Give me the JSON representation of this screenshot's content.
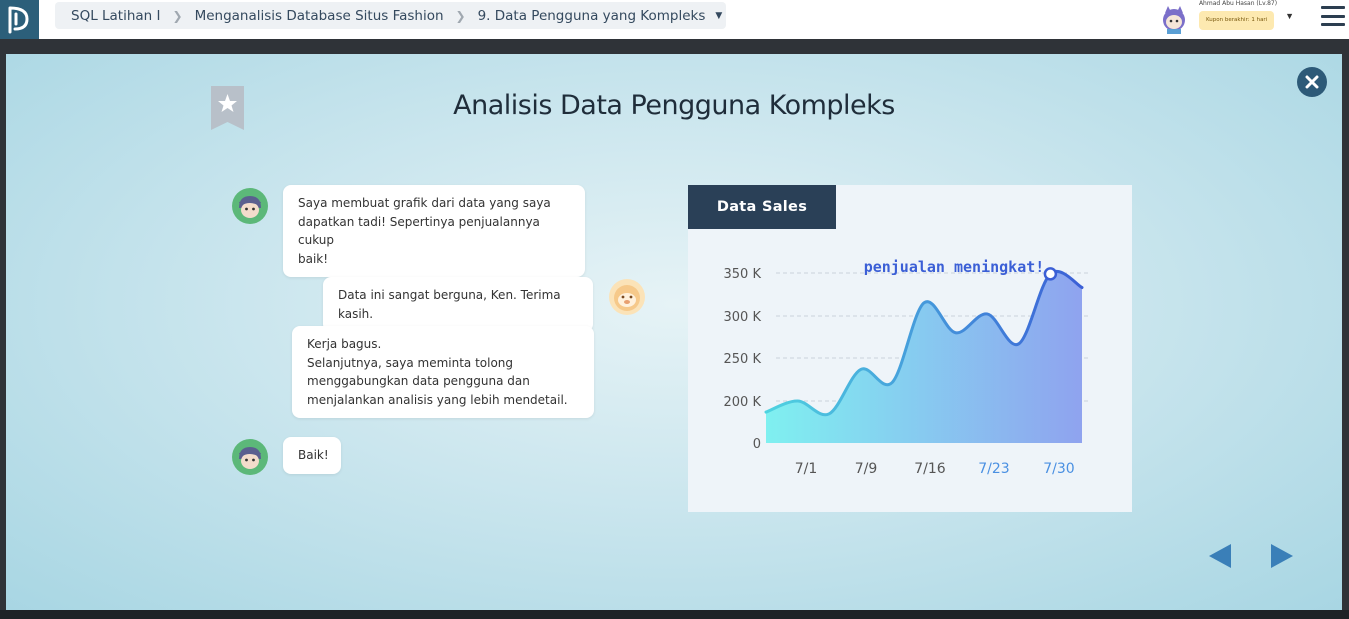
{
  "header": {
    "breadcrumb": [
      {
        "label": "SQL Latihan I"
      },
      {
        "label": "Menganalisis Database Situs Fashion"
      },
      {
        "label": "9. Data Pengguna yang Kompleks"
      }
    ],
    "user_name": "Ahmad Abu Hasan (Lv.87)",
    "coupon_text": "Kupon berakhir: 1 hari"
  },
  "modal": {
    "title": "Analisis Data Pengguna Kompleks",
    "chat": [
      {
        "speaker": "ken",
        "side": "left",
        "text": "Saya membuat grafik dari data yang saya\ndapatkan tadi! Sepertinya penjualannya cukup\nbaik!"
      },
      {
        "speaker": "user",
        "side": "right",
        "text": "Data ini sangat berguna, Ken. Terima kasih."
      },
      {
        "speaker": "ken",
        "side": "left",
        "text": "Kerja bagus.\nSelanjutnya, saya meminta tolong\nmenggabungkan data pengguna dan\nmenjalankan analisis yang lebih mendetail."
      },
      {
        "speaker": "ken",
        "side": "left",
        "text": "Baik!"
      }
    ]
  },
  "colors": {
    "accent": "#2d5a78",
    "chart_line": "#3b5fd6",
    "chart_fill_start": "#7ff0f0",
    "chart_fill_end": "#8fa3ef",
    "highlight_tick": "#4a90e2"
  },
  "chart_data": {
    "type": "area",
    "title": "Data Sales",
    "annotation": "penjualan meningkat!",
    "y_ticks": [
      "350 K",
      "300 K",
      "250 K",
      "200 K",
      "0"
    ],
    "x_ticks": [
      "7/1",
      "7/9",
      "7/16",
      "7/23",
      "7/30"
    ],
    "highlighted_x_ticks": [
      "7/23",
      "7/30"
    ],
    "grid": "horizontal dashed",
    "series": [
      {
        "values": [
          {
            "x": "7/1",
            "y": 187
          },
          {
            "x": "7/4",
            "y": 200
          },
          {
            "x": "7/7",
            "y": 185
          },
          {
            "x": "7/10",
            "y": 237
          },
          {
            "x": "7/13",
            "y": 222
          },
          {
            "x": "7/16",
            "y": 315
          },
          {
            "x": "7/19",
            "y": 280
          },
          {
            "x": "7/22",
            "y": 302
          },
          {
            "x": "7/25",
            "y": 267
          },
          {
            "x": "7/28",
            "y": 349
          },
          {
            "x": "7/31",
            "y": 333
          }
        ]
      }
    ]
  },
  "navigation": {
    "prev_icon": "triangle-left-icon",
    "next_icon": "triangle-right-icon"
  }
}
